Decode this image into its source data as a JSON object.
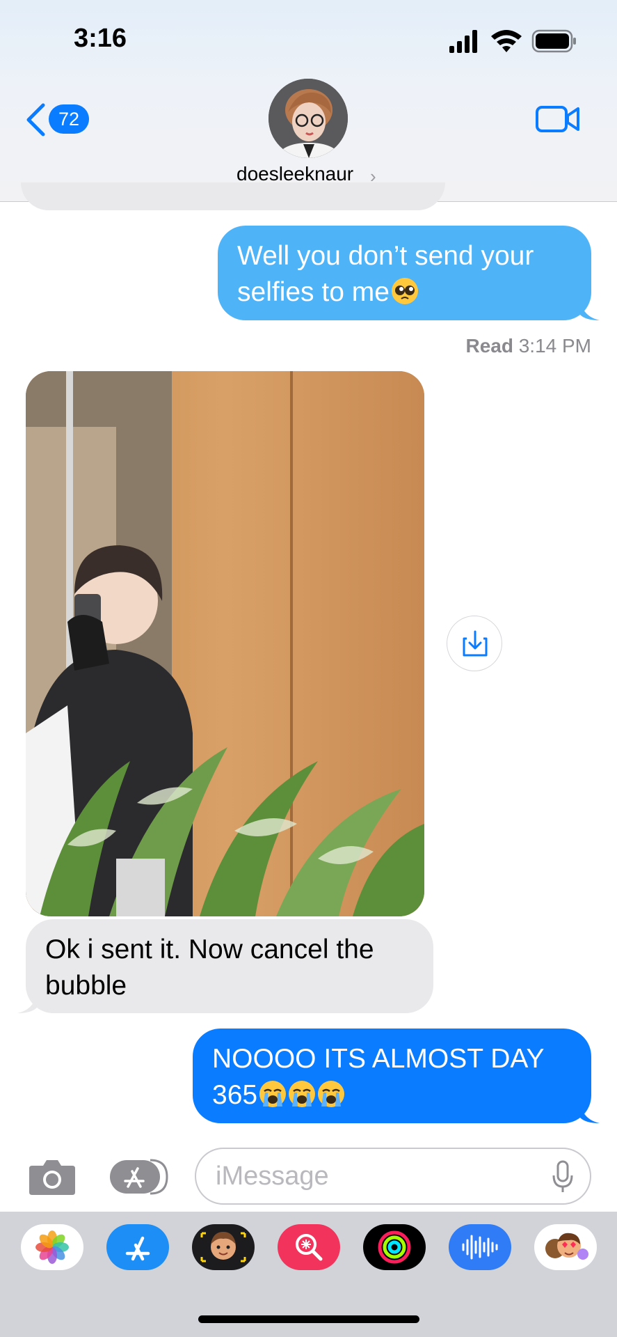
{
  "status_bar": {
    "time": "3:16"
  },
  "header": {
    "back_badge": "72",
    "contact_name": "doesleeknaur",
    "contact_chevron": "›"
  },
  "messages": [
    {
      "direction": "outgoing",
      "style": "sms-light-blue",
      "text": "Well you don’t send your selfies to me",
      "emoji": [
        "pleading-face"
      ]
    },
    {
      "type": "read-receipt",
      "label": "Read",
      "time": "3:14 PM"
    },
    {
      "direction": "incoming",
      "type": "photo",
      "description_icon": "mirror-selfie-photo"
    },
    {
      "direction": "incoming",
      "text": "Ok i sent it. Now cancel the bubble"
    },
    {
      "direction": "outgoing",
      "style": "imessage-blue",
      "text": "NOOOO ITS ALMOST DAY 365",
      "emoji": [
        "loudly-crying-face",
        "loudly-crying-face",
        "loudly-crying-face"
      ]
    }
  ],
  "input_bar": {
    "placeholder": "iMessage"
  },
  "app_drawer": [
    "photos-icon",
    "app-store-icon",
    "memoji-icon",
    "image-search-icon",
    "activity-icon",
    "audio-message-icon",
    "memoji-stickers-icon"
  ],
  "colors": {
    "imessage_blue": "#0a7cff",
    "sms_light_blue": "#4fb3f8",
    "incoming_gray": "#e9e9eb",
    "drawer_bg": "#d1d3d9"
  }
}
